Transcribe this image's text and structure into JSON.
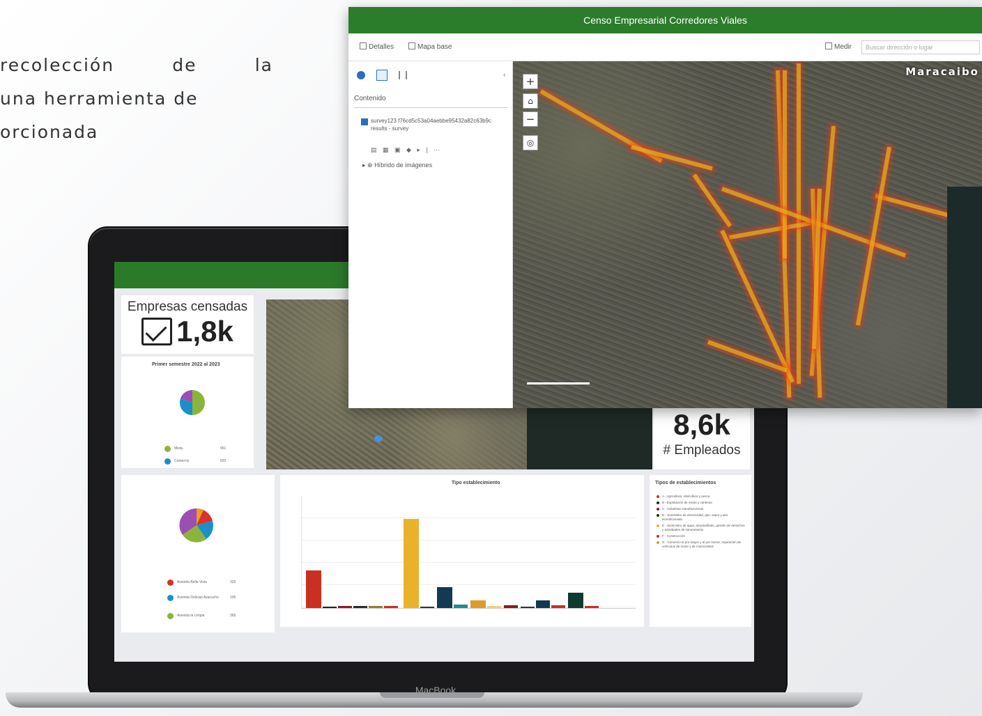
{
  "intro": {
    "line1": "recolección de la",
    "line2": "una herramienta de",
    "line3": "orcionada"
  },
  "window": {
    "title": "Censo Empresarial Corredores Viales",
    "toolbar": {
      "details": "Detalles",
      "basemap": "Mapa base",
      "measure": "Medir",
      "search_placeholder": "Buscar dirección o lugar"
    },
    "sidebar": {
      "heading": "Contenido",
      "layer_name": "survey123 f76cd5c53a04aebbe95432a82c63b9c results - survey",
      "basemap_layer": "Híbrido de imágenes"
    },
    "map": {
      "city_label": "Maracaibo"
    }
  },
  "dashboard": {
    "kpi_companies": {
      "title": "Empresas censadas",
      "value": "1,8k"
    },
    "kpi_employees": {
      "value": "8,6k",
      "title": "# Empleados"
    },
    "pie1": {
      "title": "Primer semestre 2022 al 2023",
      "legend": [
        {
          "label": "Mixta",
          "value": "961",
          "color": "#8bb53a"
        },
        {
          "label": "Comercio",
          "value": "620",
          "color": "#1a8fc9"
        }
      ]
    },
    "pie2": {
      "legend": [
        {
          "label": "Avenida Bella Vista",
          "value": "326",
          "color": "#d9322b"
        },
        {
          "label": "Avenida Delicias Ayacucho",
          "value": "195",
          "color": "#1a8fc9"
        },
        {
          "label": "Avenida la Limpia",
          "value": "365",
          "color": "#8bb53a"
        }
      ]
    },
    "bar_chart_title": "Tipo establecimiento",
    "types_panel": {
      "title": "Tipos de establecimientos",
      "items": [
        "A - Agricultura, silvicultura y pesca",
        "B - Explotación de minas y canteras",
        "C - Industrias manufactureras",
        "D - Suministro de electricidad, gas, vapor y aire acondicionado",
        "E - Suministro de agua; alcantarillado, gestión de desechos y actividades de saneamiento",
        "F - Construcción",
        "G - Comercio al por mayor y al por menor; reparación de vehículos de motor y de motocicletas"
      ]
    }
  },
  "laptop": {
    "brand": "MacBook"
  }
}
